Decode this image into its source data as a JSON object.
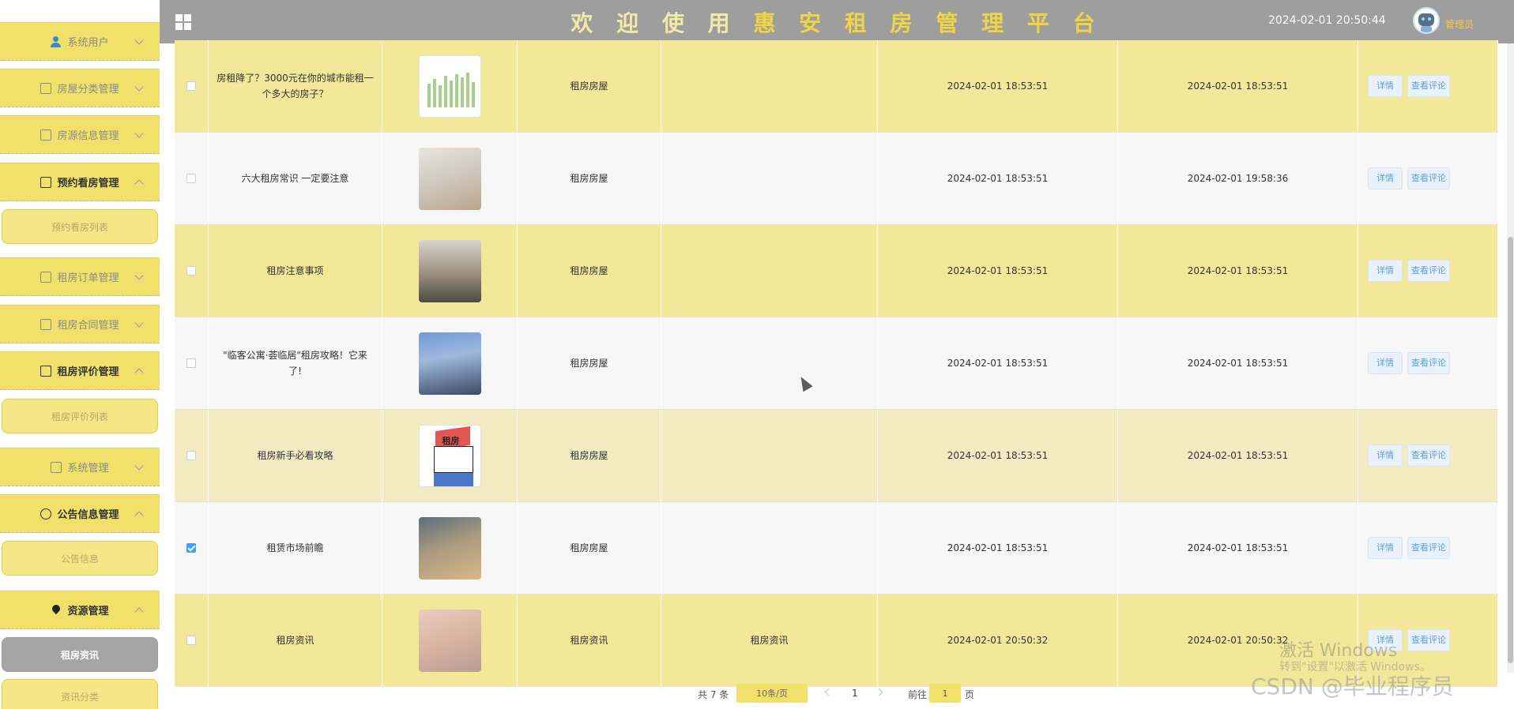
{
  "header": {
    "title_plain": "欢 迎 使 用",
    "title_highlight": "惠 安",
    "title_rest": "租 房 管 理 平 台",
    "datetime": "2024-02-01 20:50:44",
    "user_label": "管理员"
  },
  "sidebar": {
    "items": [
      {
        "label": "系统用户",
        "icon": "user-icon",
        "open": false
      },
      {
        "label": "房屋分类管理",
        "icon": "edit-icon",
        "open": false
      },
      {
        "label": "房源信息管理",
        "icon": "edit-icon",
        "open": false
      },
      {
        "label": "预约看房管理",
        "icon": "edit-icon",
        "open": true
      },
      {
        "label": "租房订单管理",
        "icon": "edit-icon",
        "open": false
      },
      {
        "label": "租房合同管理",
        "icon": "edit-icon",
        "open": false
      },
      {
        "label": "租房评价管理",
        "icon": "edit-icon",
        "open": true
      },
      {
        "label": "系统管理",
        "icon": "image-icon",
        "open": false
      },
      {
        "label": "公告信息管理",
        "icon": "info-icon",
        "open": true
      },
      {
        "label": "资源管理",
        "icon": "location-icon",
        "open": true
      }
    ],
    "subitems": [
      {
        "label": "预约看房列表",
        "active": false
      },
      {
        "label": "租房评价列表",
        "active": false
      },
      {
        "label": "公告信息",
        "active": false
      },
      {
        "label": "租房资讯",
        "active": true
      },
      {
        "label": "资讯分类",
        "active": false
      }
    ]
  },
  "table": {
    "rows": [
      {
        "title": "房租降了？3000元在你的城市能租一个多大的房子？",
        "type": "租房房屋",
        "category": "",
        "created": "2024-02-01 18:53:51",
        "updated": "2024-02-01 18:53:51",
        "checked": false,
        "thumb": "chart-thumbnail"
      },
      {
        "title": "六大租房常识 一定要注意",
        "type": "租房房屋",
        "category": "",
        "created": "2024-02-01 18:53:51",
        "updated": "2024-02-01 19:58:36",
        "checked": false,
        "thumb": "bedroom-photo"
      },
      {
        "title": "租房注意事项",
        "type": "租房房屋",
        "category": "",
        "created": "2024-02-01 18:53:51",
        "updated": "2024-02-01 18:53:51",
        "checked": false,
        "thumb": "living-room-photo"
      },
      {
        "title": "\"临客公寓·荟临居\"租房攻略！它来了!",
        "type": "租房房屋",
        "category": "",
        "created": "2024-02-01 18:53:51",
        "updated": "2024-02-01 18:53:51",
        "checked": false,
        "thumb": "building-photo"
      },
      {
        "title": "租房新手必看攻略",
        "type": "租房房屋",
        "category": "",
        "created": "2024-02-01 18:53:51",
        "updated": "2024-02-01 18:53:51",
        "checked": false,
        "thumb": "house-illustration"
      },
      {
        "title": "租赁市场前瞻",
        "type": "租房房屋",
        "category": "",
        "created": "2024-02-01 18:53:51",
        "updated": "2024-02-01 18:53:51",
        "checked": true,
        "thumb": "apartment-photo"
      },
      {
        "title": "租房资讯",
        "type": "租房资讯",
        "category": "租房资讯",
        "created": "2024-02-01 20:50:32",
        "updated": "2024-02-01 20:50:32",
        "checked": false,
        "thumb": "room-photo"
      }
    ],
    "detail_label": "详情",
    "comments_label": "查看评论",
    "thumb_text": "租房"
  },
  "pagination": {
    "total": "共 7 条",
    "page_size": "10条/页",
    "current_page": "1",
    "goto_prefix": "前往",
    "goto_value": "1",
    "goto_suffix": "页"
  },
  "overlay": {
    "activate_title": "激活 Windows",
    "activate_sub": "转到\"设置\"以激活 Windows。",
    "csdn": "CSDN @毕业程序员"
  },
  "colors": {
    "accent": "#f1e06a",
    "header": "#9e9e9e",
    "active_item": "#a5a5a5",
    "link": "#5e9ed6"
  }
}
